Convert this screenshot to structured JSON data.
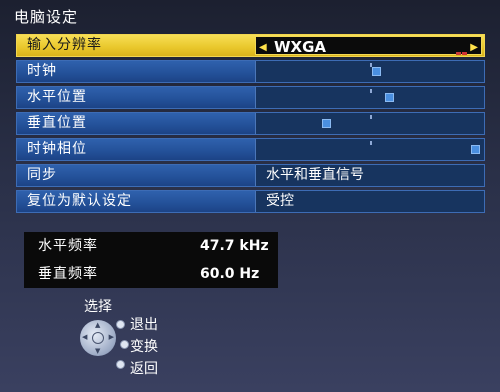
{
  "title": "电脑设定",
  "menu": {
    "items": [
      {
        "label": "输入分辨率",
        "value": "WXGA",
        "kind": "select",
        "selected": true
      },
      {
        "label": "时钟",
        "kind": "slider",
        "level": 0.53
      },
      {
        "label": "水平位置",
        "kind": "slider",
        "level": 0.59
      },
      {
        "label": "垂直位置",
        "kind": "slider",
        "level": 0.3
      },
      {
        "label": "时钟相位",
        "kind": "slider",
        "level": 0.98
      },
      {
        "label": "同步",
        "value": "水平和垂直信号",
        "kind": "text"
      },
      {
        "label": "复位为默认设定",
        "value": "受控",
        "kind": "text"
      }
    ]
  },
  "info": {
    "h_freq_label": "水平频率",
    "h_freq_value": "47.7 kHz",
    "v_freq_label": "垂直频率",
    "v_freq_value": "60.0 Hz"
  },
  "help": {
    "select": "选择",
    "exit": "退出",
    "change": "变换",
    "back": "返回"
  },
  "colors": {
    "selected_row": "#e9c72b",
    "row": "#24529a",
    "value_bg": "#17345f",
    "slider_thumb": "#4a8fe0"
  },
  "icons": [
    "left-arrow-icon",
    "right-arrow-icon",
    "indicator-icon",
    "dpad-icon",
    "button-dot-icon"
  ]
}
